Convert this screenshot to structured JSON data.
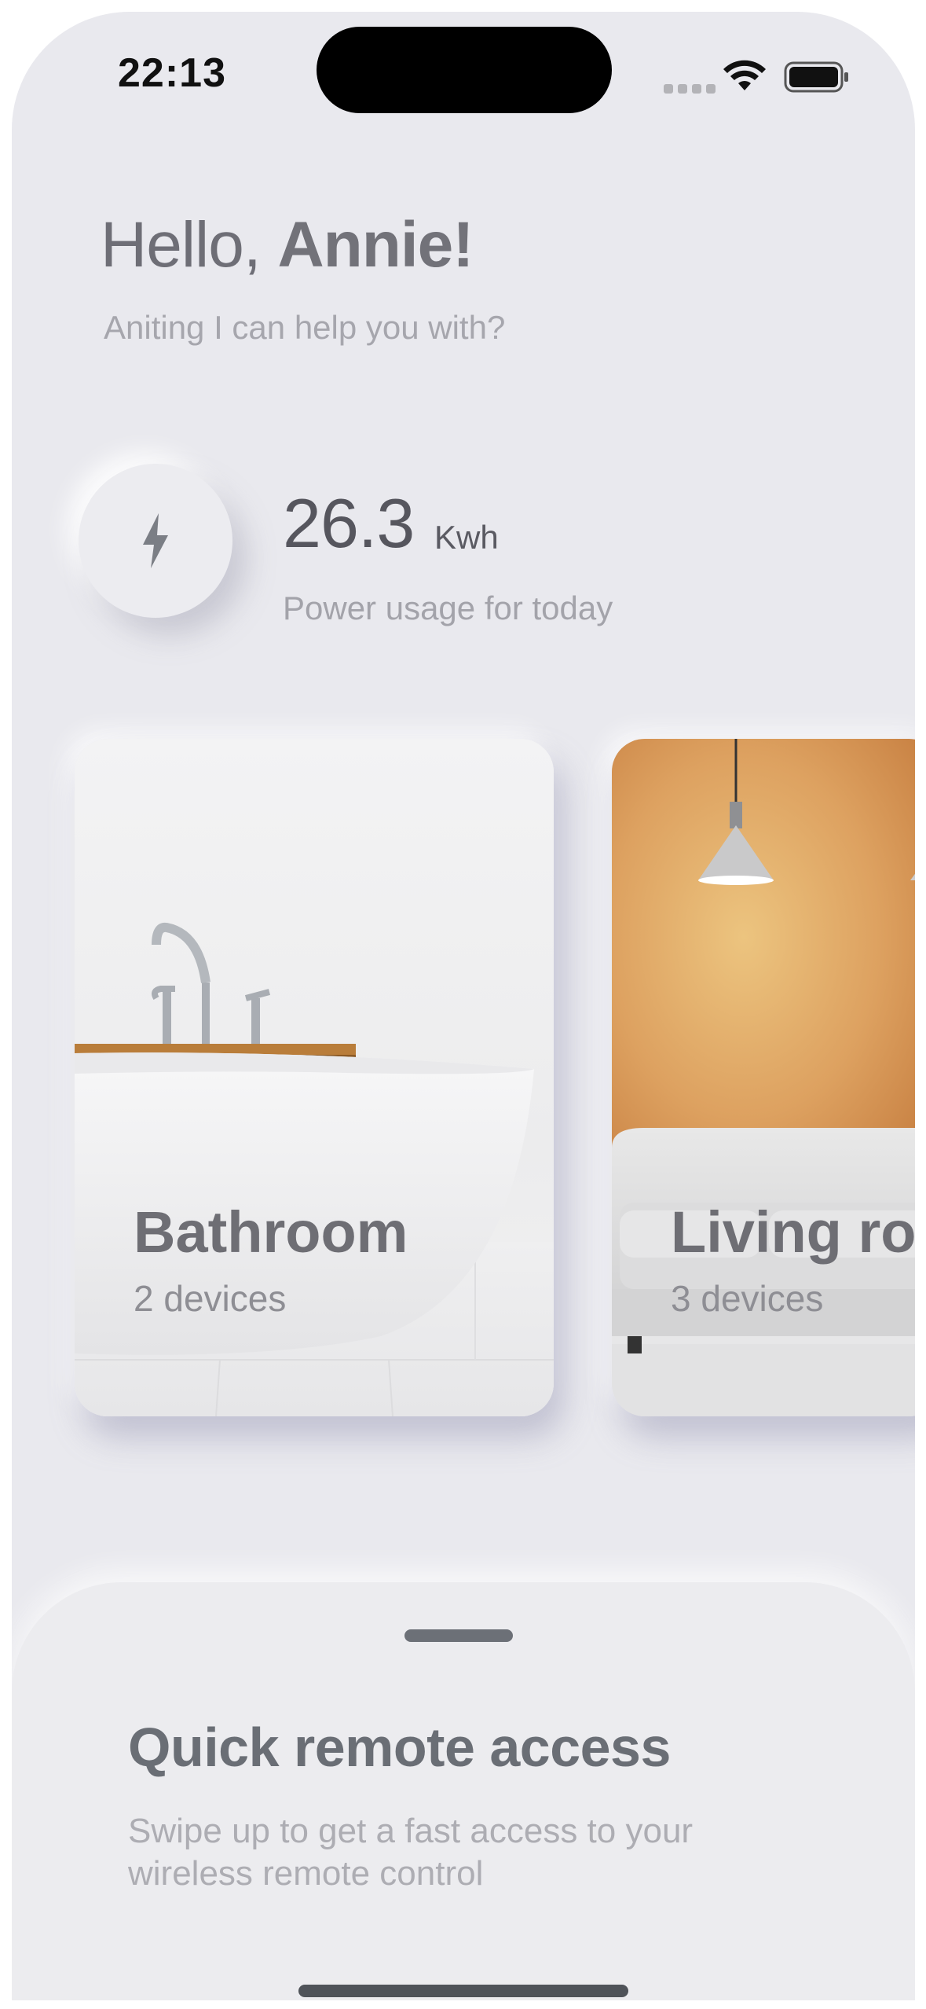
{
  "status_bar": {
    "time": "22:13"
  },
  "greeting": {
    "hello": "Hello,",
    "name": "Annie!",
    "subtitle": "Aniting I can help you with?"
  },
  "power": {
    "value": "26.3",
    "unit": "Kwh",
    "label": "Power usage for today",
    "icon": "bolt-icon"
  },
  "rooms": [
    {
      "name": "Bathroom",
      "devices": "2 devices"
    },
    {
      "name": "Living room",
      "devices": "3 devices"
    }
  ],
  "quick_access": {
    "title": "Quick remote access",
    "subtitle": "Swipe up to get a fast access to your wireless remote control"
  },
  "colors": {
    "background": "#e9e9ee",
    "text_primary": "#6e6e74",
    "text_secondary": "#a6a6ad",
    "accent_wall": "#d08a42"
  }
}
